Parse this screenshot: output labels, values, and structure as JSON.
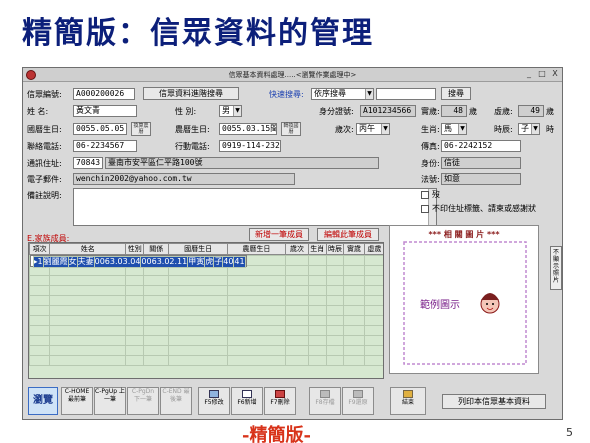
{
  "slide": {
    "title": "精簡版：信眾資料的管理",
    "footer_tag": "-精簡版-",
    "page_number": "5"
  },
  "window": {
    "title": "信眾基本資料處理.....<瀏覽作業處理中>",
    "min": "_",
    "max": "□",
    "close": "X"
  },
  "header": {
    "id_label": "信眾編號:",
    "id_value": "A000200026",
    "search_btn": "信眾資料進階搜尋",
    "quick_label": "快速搜尋:",
    "quick_mode": "依序搜尋",
    "quick_value": "",
    "quick_btn": "搜尋"
  },
  "form": {
    "name_label": "姓 名:",
    "name_value": "黃文青",
    "gender_label": "性 別:",
    "gender_value": "男",
    "idcard_label": "身分證號:",
    "idcard_value": "A101234566",
    "age_label": "實歲:",
    "age_value": "48",
    "age_unit": "歲",
    "vage_label": "虛歲:",
    "vage_value": "49",
    "vage_unit": "歲",
    "birth_label": "國曆生日:",
    "birth_value": "0055.05.05",
    "birth_btn": "換算農曆",
    "lunar_label": "農曆生日:",
    "lunar_value": "0055.03.15閏",
    "lunar_btn": "轉換國曆",
    "year_label": "歲次:",
    "year_value": "丙午",
    "zodiac_label": "生肖:",
    "zodiac_value": "馬",
    "hour_label": "時辰:",
    "hour_value": "子",
    "hour_unit": "時",
    "phone_label": "聯絡電話:",
    "phone_value": "06-2234567",
    "mobile_label": "行動電話:",
    "mobile_value": "0919-114-232",
    "fax_label": "傳真:",
    "fax_value": "06-2242152",
    "addr_label": "通訊住址:",
    "zip_value": "70843",
    "addr_value": "臺南市安平區仁平路100號",
    "identity_label": "身份:",
    "identity_value": "信徒",
    "email_label": "電子郵件:",
    "email_value": "wenchin2002@yahoo.com.tw",
    "dharma_label": "法號:",
    "dharma_value": "如意",
    "remark_label": "備註說明:",
    "deceased_label": "歿",
    "nolabel_label": "不印住址標籤、請柬或感謝狀"
  },
  "family": {
    "title": "E.家族成員:",
    "add_btn": "新增一筆成員",
    "edit_btn": "編輯此筆成員",
    "columns": [
      "項次",
      "姓名",
      "性別",
      "關係",
      "國曆生日",
      "農曆生日",
      "歲次",
      "生肖",
      "時辰",
      "實歲",
      "虛歲"
    ],
    "rows": [
      {
        "mark": "▸",
        "no": "1",
        "name": "劉麗霞",
        "gender": "女",
        "relation": "夫妻",
        "solar": "0063.03.04",
        "lunar": "0063.02.11",
        "year": "甲寅",
        "zodiac": "虎",
        "hour": "子",
        "age": "40",
        "vage": "41"
      }
    ]
  },
  "photo": {
    "header": "*** 相 關 圖 片 ***",
    "example": "範例圖示",
    "side_btn": "不顯示照片"
  },
  "toolbar": [
    {
      "key": "browse",
      "label": "瀏覽",
      "enabled": true
    },
    {
      "key": "first",
      "label": "C-HOME 最前筆",
      "enabled": true
    },
    {
      "key": "prev",
      "label": "C-PgUp 上一筆",
      "enabled": true
    },
    {
      "key": "next",
      "label": "C-PgDn 下一筆",
      "enabled": false
    },
    {
      "key": "last",
      "label": "C-END 最後筆",
      "enabled": false
    },
    {
      "key": "edit",
      "label": "F5修改",
      "enabled": true
    },
    {
      "key": "new",
      "label": "F6新增",
      "enabled": true
    },
    {
      "key": "delete",
      "label": "F7刪除",
      "enabled": true
    },
    {
      "key": "save",
      "label": "F8存檔",
      "enabled": false
    },
    {
      "key": "undo",
      "label": "F9還原",
      "enabled": false
    },
    {
      "key": "exit",
      "label": "結束",
      "enabled": true
    }
  ],
  "print_btn": "列印本信眾基本資料"
}
